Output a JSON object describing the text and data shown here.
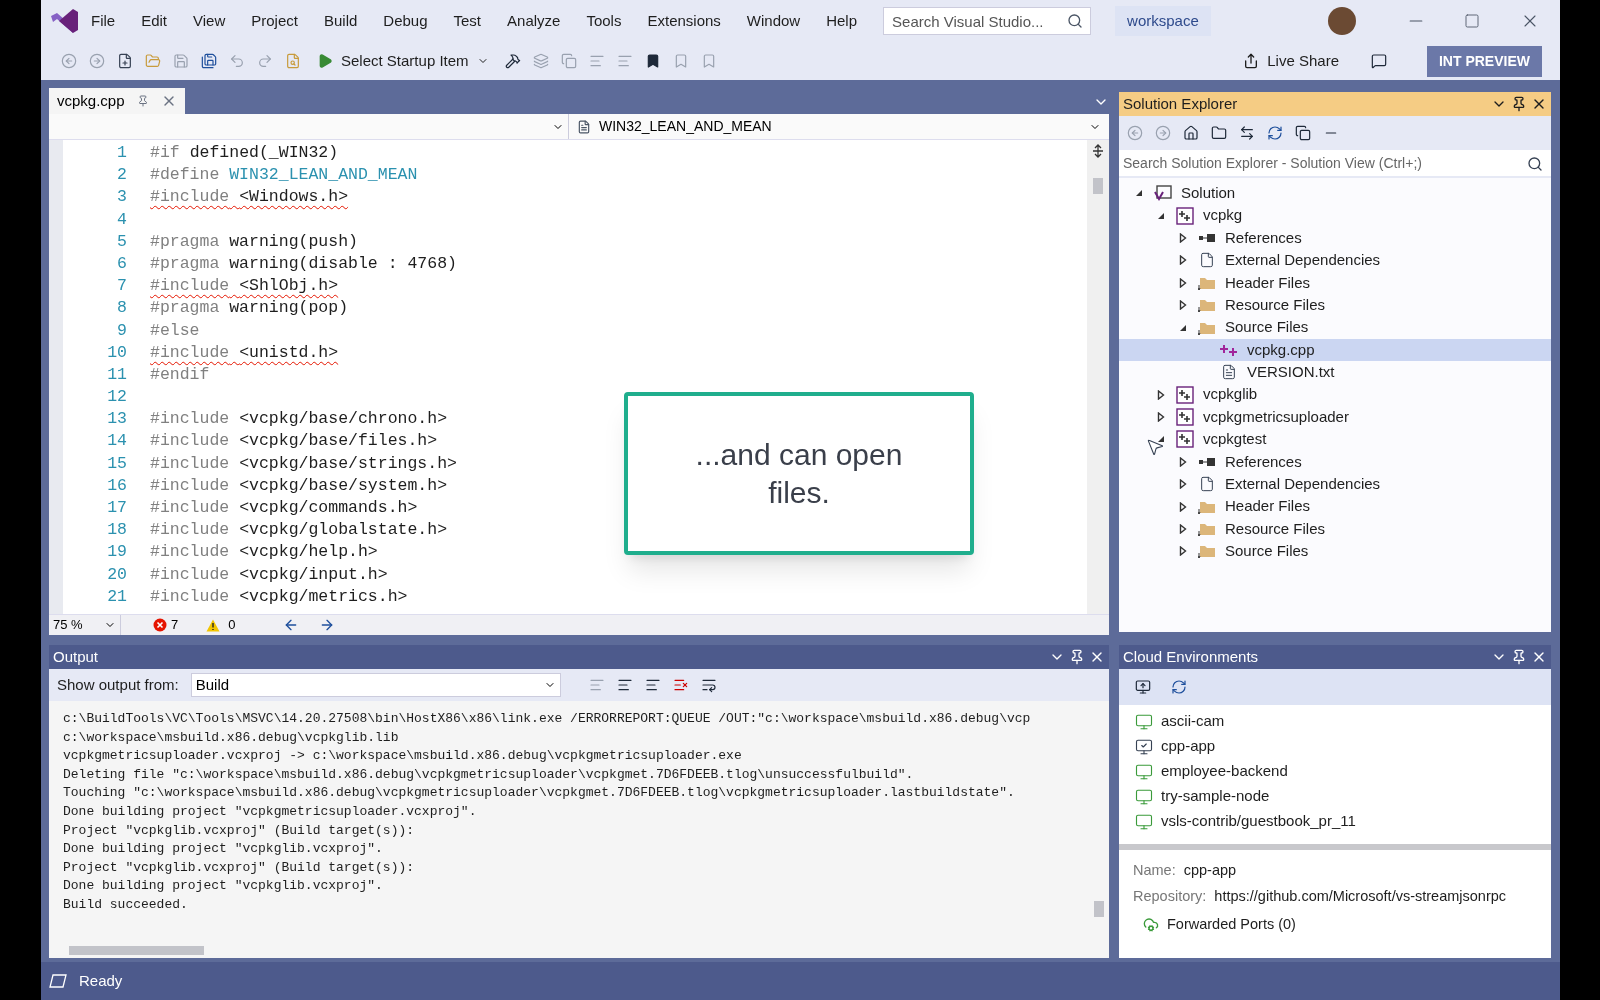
{
  "menu": {
    "items": [
      "File",
      "Edit",
      "View",
      "Project",
      "Build",
      "Debug",
      "Test",
      "Analyze",
      "Tools",
      "Extensions",
      "Window",
      "Help"
    ]
  },
  "search": {
    "placeholder": "Search Visual Studio..."
  },
  "workspace": "workspace",
  "toolbar": {
    "startup_item": "Select Startup Item",
    "live_share": "Live Share",
    "preview_badge": "INT PREVIEW"
  },
  "editor": {
    "tab": {
      "label": "vcpkg.cpp",
      "selected": true
    },
    "scope": "WIN32_LEAN_AND_MEAN",
    "lines": [
      {
        "number": "1",
        "directive": "#if",
        "text": "defined(_WIN32)",
        "kind": "plain",
        "squiggle": false
      },
      {
        "number": "2",
        "directive": "#define",
        "text": "WIN32_LEAN_AND_MEAN",
        "kind": "macro",
        "squiggle": false
      },
      {
        "number": "3",
        "directive": "#include",
        "text": "<Windows.h>",
        "kind": "plain",
        "squiggle": true
      },
      {
        "number": "4"
      },
      {
        "number": "5",
        "directive": "#pragma",
        "text": "warning(push)",
        "kind": "plain",
        "squiggle": false
      },
      {
        "number": "6",
        "directive": "#pragma",
        "text": "warning(disable : 4768)",
        "kind": "plain",
        "squiggle": false
      },
      {
        "number": "7",
        "directive": "#include",
        "text": "<ShlObj.h>",
        "kind": "plain",
        "squiggle": true
      },
      {
        "number": "8",
        "directive": "#pragma",
        "text": "warning(pop)",
        "kind": "plain",
        "squiggle": false
      },
      {
        "number": "9",
        "directive": "#else",
        "kind": "plain",
        "squiggle": false
      },
      {
        "number": "10",
        "directive": "#include",
        "text": "<unistd.h>",
        "kind": "plain",
        "squiggle": true
      },
      {
        "number": "11",
        "directive": "#endif",
        "kind": "plain",
        "squiggle": false
      },
      {
        "number": "12"
      },
      {
        "number": "13",
        "directive": "#include",
        "text": "<vcpkg/base/chrono.h>",
        "kind": "plain",
        "squiggle": false
      },
      {
        "number": "14",
        "directive": "#include",
        "text": "<vcpkg/base/files.h>",
        "kind": "plain",
        "squiggle": false
      },
      {
        "number": "15",
        "directive": "#include",
        "text": "<vcpkg/base/strings.h>",
        "kind": "plain",
        "squiggle": false
      },
      {
        "number": "16",
        "directive": "#include",
        "text": "<vcpkg/base/system.h>",
        "kind": "plain",
        "squiggle": false
      },
      {
        "number": "17",
        "directive": "#include",
        "text": "<vcpkg/commands.h>",
        "kind": "plain",
        "squiggle": false
      },
      {
        "number": "18",
        "directive": "#include",
        "text": "<vcpkg/globalstate.h>",
        "kind": "plain",
        "squiggle": false
      },
      {
        "number": "19",
        "directive": "#include",
        "text": "<vcpkg/help.h>",
        "kind": "plain",
        "squiggle": false
      },
      {
        "number": "20",
        "directive": "#include",
        "text": "<vcpkg/input.h>",
        "kind": "plain",
        "squiggle": false
      },
      {
        "number": "21",
        "directive": "#include",
        "text": "<vcpkg/metrics.h>",
        "kind": "plain",
        "squiggle": false
      }
    ],
    "zoom": "75 %",
    "errors": "7",
    "warnings": "0"
  },
  "callout": {
    "text": "...and can open files."
  },
  "solution_explorer": {
    "title": "Solution Explorer",
    "search": {
      "placeholder": "Search Solution Explorer - Solution View (Ctrl+;)"
    },
    "tree": [
      {
        "label": "Solution",
        "kind": "solution",
        "expanded": true,
        "selected": false,
        "children": [
          {
            "label": "vcpkg",
            "kind": "project",
            "expanded": true,
            "selected": false,
            "children": [
              {
                "label": "References",
                "kind": "references",
                "expanded": false,
                "selected": false
              },
              {
                "label": "External Dependencies",
                "kind": "dependencies",
                "expanded": false,
                "selected": false
              },
              {
                "label": "Header Files",
                "kind": "folder",
                "expanded": false,
                "selected": false
              },
              {
                "label": "Resource Files",
                "kind": "folder",
                "expanded": false,
                "selected": false
              },
              {
                "label": "Source Files",
                "kind": "folder",
                "expanded": true,
                "selected": false,
                "children": [
                  {
                    "label": "vcpkg.cpp",
                    "kind": "cpp",
                    "selected": true
                  },
                  {
                    "label": "VERSION.txt",
                    "kind": "text",
                    "selected": false
                  }
                ]
              }
            ]
          },
          {
            "label": "vcpkglib",
            "kind": "project",
            "expanded": false,
            "selected": false
          },
          {
            "label": "vcpkgmetricsuploader",
            "kind": "project",
            "expanded": false,
            "selected": false
          },
          {
            "label": "vcpkgtest",
            "kind": "project",
            "expanded": true,
            "selected": false,
            "children": [
              {
                "label": "References",
                "kind": "references",
                "expanded": false,
                "selected": false
              },
              {
                "label": "External Dependencies",
                "kind": "dependencies",
                "expanded": false,
                "selected": false
              },
              {
                "label": "Header Files",
                "kind": "folder",
                "expanded": false,
                "selected": false
              },
              {
                "label": "Resource Files",
                "kind": "folder",
                "expanded": false,
                "selected": false
              },
              {
                "label": "Source Files",
                "kind": "folder",
                "expanded": false,
                "selected": false
              }
            ]
          }
        ]
      }
    ]
  },
  "output": {
    "title": "Output",
    "source_label": "Show output from:",
    "source": "Build",
    "lines": [
      "c:\\BuildTools\\VC\\Tools\\MSVC\\14.20.27508\\bin\\HostX86\\x86\\link.exe /ERRORREPORT:QUEUE /OUT:\"c:\\workspace\\msbuild.x86.debug\\vcp",
      "c:\\workspace\\msbuild.x86.debug\\vcpkglib.lib",
      "vcpkgmetricsuploader.vcxproj -> c:\\workspace\\msbuild.x86.debug\\vcpkgmetricsuploader.exe",
      "Deleting file \"c:\\workspace\\msbuild.x86.debug\\vcpkgmetricsuploader\\vcpkgmet.7D6FDEEB.tlog\\unsuccessfulbuild\".",
      "Touching \"c:\\workspace\\msbuild.x86.debug\\vcpkgmetricsuploader\\vcpkgmet.7D6FDEEB.tlog\\vcpkgmetricsuploader.lastbuildstate\".",
      "Done building project \"vcpkgmetricsuploader.vcxproj\".",
      "Project \"vcpkglib.vcxproj\" (Build target(s)):",
      "Done building project \"vcpkglib.vcxproj\".",
      "Project \"vcpkglib.vcxproj\" (Build target(s)):",
      "Done building project \"vcpkglib.vcxproj\".",
      "Build succeeded."
    ]
  },
  "cloud": {
    "title": "Cloud Environments",
    "items": [
      {
        "label": "ascii-cam",
        "connected": false
      },
      {
        "label": "cpp-app",
        "connected": true
      },
      {
        "label": "employee-backend",
        "connected": false
      },
      {
        "label": "try-sample-node",
        "connected": false
      },
      {
        "label": "vsls-contrib/guestbook_pr_11",
        "connected": false
      }
    ],
    "name_label": "Name:",
    "name": "cpp-app",
    "repo_label": "Repository:",
    "repo": "https://github.com/Microsoft/vs-streamjsonrpc",
    "ports": "Forwarded Ports (0)"
  },
  "status_bar": {
    "text": "Ready"
  }
}
